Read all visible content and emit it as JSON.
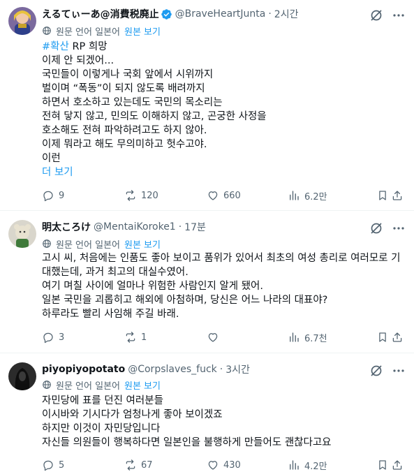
{
  "posts": [
    {
      "display_name": "えるてぃーあ@消費税廃止",
      "handle": "@BraveHeartJunta",
      "time": "2시간",
      "verified": true,
      "translate_label": "원문 언어 일본어",
      "view_original": "원본 보기",
      "hashtag": "#확산",
      "first_line_rest": " RP 희망",
      "lines": [
        "이제 안 되겠어...",
        "국민들이 이렇게나 국회 앞에서 시위까지",
        "벌이며 “폭동”이 되지 않도록 배려까지",
        "하면서 호소하고 있는데도 국민의 목소리는",
        "전혀 닿지 않고, 민의도 이해하지 않고, 곤궁한 사정을",
        "호소해도 전혀 파악하려고도 하지 않아.",
        "이제 뭐라고 해도 무의미하고 헛수고야.",
        "이런"
      ],
      "show_more": "더 보기",
      "replies": "9",
      "reposts": "120",
      "likes": "660",
      "views": "6.2만"
    },
    {
      "display_name": "明太ころけ",
      "handle": "@MentaiKoroke1",
      "time": "17분",
      "translate_label": "원문 언어 일본어",
      "view_original": "원본 보기",
      "lines": [
        "고시 씨, 처음에는 인품도 좋아 보이고 품위가 있어서 최초의 여성 총리로 여러모로 기",
        "대했는데, 과거 최고의 대실수였어.",
        "여기 며칠 사이에 얼마나 위험한 사람인지 알게 됐어.",
        "일본 국민을 괴롭히고 해외에 아첨하며, 당신은 어느 나라의 대표야?",
        "하루라도 빨리 사임해 주길 바래."
      ],
      "replies": "3",
      "reposts": "1",
      "likes": "",
      "views": "6.7천"
    },
    {
      "display_name": "piyopiyopotato",
      "handle": "@Corpslaves_fuck",
      "time": "3시간",
      "translate_label": "원문 언어 일본어",
      "view_original": "원본 보기",
      "lines": [
        "자민당에 표를 던진 여러분들",
        "이시바와 기시다가 엄청나게 좋아 보이겠죠",
        "하지만 이것이 자민당입니다",
        "자신들 의원들이 행복하다면 일본인을 불행하게 만들어도 괜찮다고요"
      ],
      "replies": "5",
      "reposts": "67",
      "likes": "430",
      "views": "4.2만"
    }
  ],
  "colors": {
    "link": "#1d9bf0",
    "secondary": "#536471",
    "text": "#0f1419",
    "divider": "#eff3f4"
  }
}
